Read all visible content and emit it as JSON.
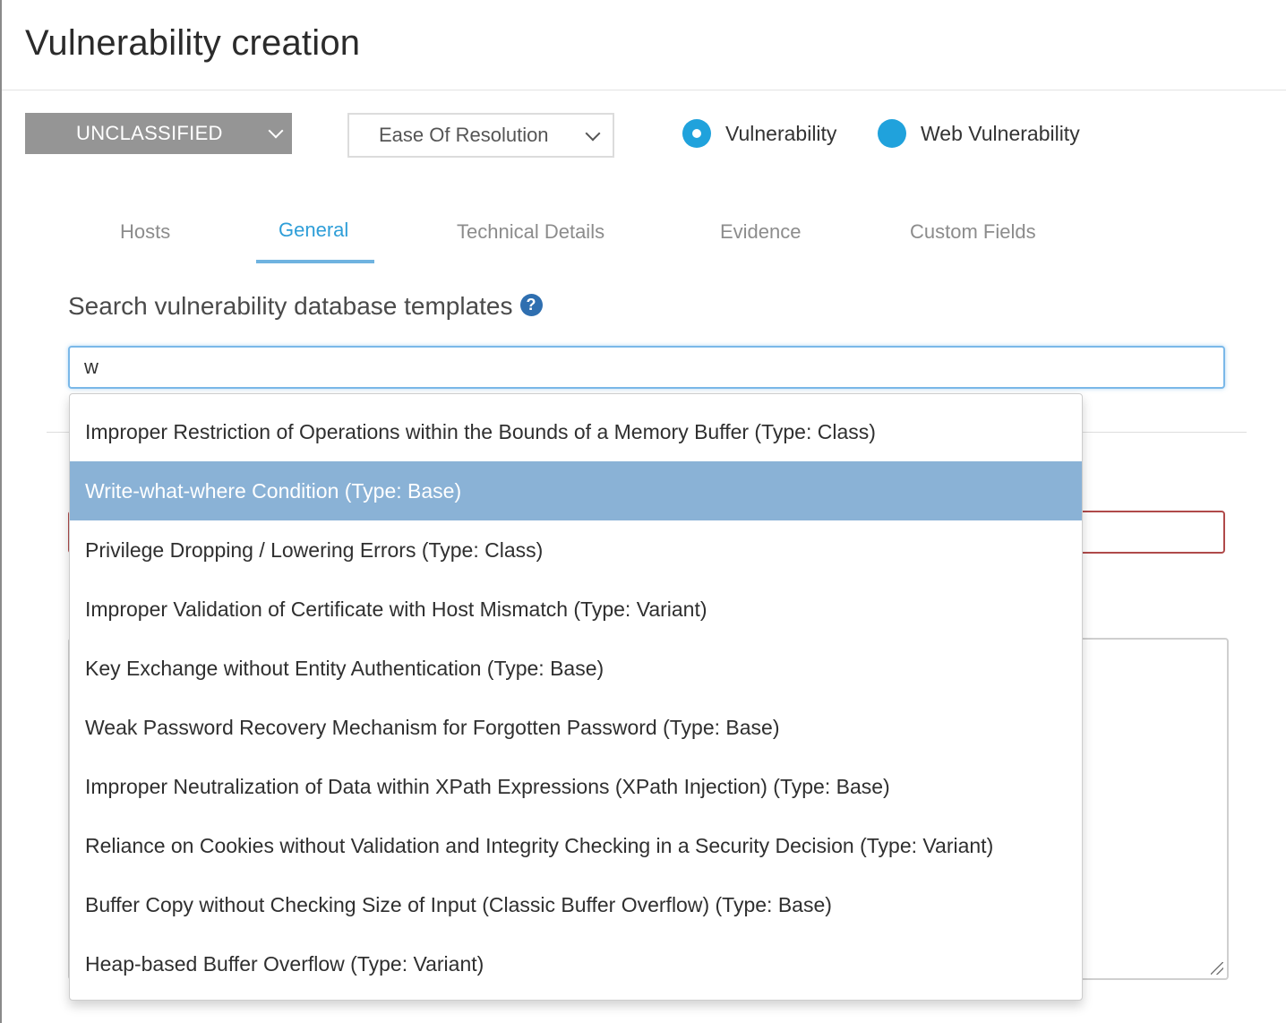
{
  "window": {
    "title": "Vulnerability creation"
  },
  "toolbar": {
    "severity_label": "UNCLASSIFIED",
    "ease_label": "Ease Of Resolution",
    "radio_vulnerability": "Vulnerability",
    "radio_web_vulnerability": "Web Vulnerability",
    "selected_type": "Vulnerability",
    "accent_color": "#20a2dc",
    "severity_color": "#959595"
  },
  "tabs": [
    {
      "label": "Hosts"
    },
    {
      "label": "General"
    },
    {
      "label": "Technical Details"
    },
    {
      "label": "Evidence"
    },
    {
      "label": "Custom Fields"
    }
  ],
  "active_tab": "General",
  "search": {
    "label": "Search vulnerability database templates",
    "help_icon": "question-circle-icon",
    "value": "w"
  },
  "suggestions": {
    "highlight_color": "#8ab2d6",
    "active_index": 1,
    "items": [
      {
        "label": "Improper Restriction of Operations within the Bounds of a Memory Buffer (Type: Class)"
      },
      {
        "label": "Write-what-where Condition (Type: Base)"
      },
      {
        "label": "Privilege Dropping / Lowering Errors (Type: Class)"
      },
      {
        "label": "Improper Validation of Certificate with Host Mismatch (Type: Variant)"
      },
      {
        "label": "Key Exchange without Entity Authentication (Type: Base)"
      },
      {
        "label": "Weak Password Recovery Mechanism for Forgotten Password (Type: Base)"
      },
      {
        "label": "Improper Neutralization of Data within XPath Expressions (XPath Injection) (Type: Base)"
      },
      {
        "label": "Reliance on Cookies without Validation and Integrity Checking in a Security Decision (Type: Variant)"
      },
      {
        "label": "Buffer Copy without Checking Size of Input (Classic Buffer Overflow) (Type: Base)"
      },
      {
        "label": "Heap-based Buffer Overflow (Type: Variant)"
      }
    ]
  }
}
